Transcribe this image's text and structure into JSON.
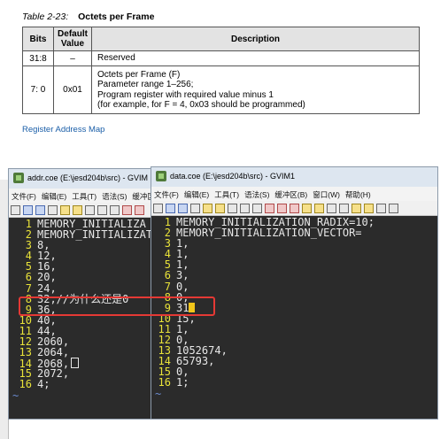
{
  "document": {
    "caption_prefix": "Table 2-23:",
    "caption_title": "Octets per Frame",
    "headers": [
      "Bits",
      "Default Value",
      "Description"
    ],
    "rows": [
      {
        "bits": "31:8",
        "default": "–",
        "description": [
          "Reserved"
        ]
      },
      {
        "bits": "7: 0",
        "default": "0x01",
        "description": [
          "Octets per Frame (F)",
          "Parameter range 1–256;",
          "Program register with required value minus 1",
          "(for example, for F = 4, 0x03 should be programmed)"
        ]
      }
    ],
    "link": "Register Address Map"
  },
  "left_window": {
    "title": "addr.coe (E:\\jesd204b\\src) - GVIM",
    "menu": [
      "文件(F)",
      "编辑(E)",
      "工具(T)",
      "语法(S)",
      "缓冲区"
    ],
    "lines": [
      {
        "n": "1",
        "text": "MEMORY_INITIALIZA"
      },
      {
        "n": "2",
        "text": "MEMORY_INITIALIZAT"
      },
      {
        "n": "3",
        "text": "8,"
      },
      {
        "n": "4",
        "text": "12,"
      },
      {
        "n": "5",
        "text": "16,"
      },
      {
        "n": "6",
        "text": "20,"
      },
      {
        "n": "7",
        "text": "24,"
      },
      {
        "n": "8",
        "text": "32,//为什么还是0"
      },
      {
        "n": "9",
        "text": "36,"
      },
      {
        "n": "10",
        "text": "40,"
      },
      {
        "n": "11",
        "text": "44,"
      },
      {
        "n": "12",
        "text": "2060,"
      },
      {
        "n": "13",
        "text": "2064,"
      },
      {
        "n": "14",
        "text": "2068,"
      },
      {
        "n": "15",
        "text": "2072,"
      },
      {
        "n": "16",
        "text": "4;"
      }
    ],
    "tilde": "~"
  },
  "right_window": {
    "title": "data.coe (E:\\jesd204b\\src) - GVIM1",
    "menu": [
      "文件(F)",
      "编辑(E)",
      "工具(T)",
      "语法(S)",
      "缓冲区(B)",
      "窗口(W)",
      "帮助(H)"
    ],
    "lines": [
      {
        "n": "1",
        "text": "MEMORY_INITIALIZATION_RADIX=10;"
      },
      {
        "n": "2",
        "text": "MEMORY_INITIALIZATION_VECTOR="
      },
      {
        "n": "3",
        "text": "1,"
      },
      {
        "n": "4",
        "text": "1,"
      },
      {
        "n": "5",
        "text": "1,"
      },
      {
        "n": "6",
        "text": "3,"
      },
      {
        "n": "7",
        "text": "0,"
      },
      {
        "n": "8",
        "text": "0,"
      },
      {
        "n": "9",
        "text": "31"
      },
      {
        "n": "10",
        "text": "15,"
      },
      {
        "n": "11",
        "text": "1,"
      },
      {
        "n": "12",
        "text": "0,"
      },
      {
        "n": "13",
        "text": "1052674,"
      },
      {
        "n": "14",
        "text": "65793,"
      },
      {
        "n": "15",
        "text": "0,"
      },
      {
        "n": "16",
        "text": "1;"
      }
    ],
    "tilde": "~"
  },
  "colors": {
    "editor_bg": "#2b2b2b",
    "line_number": "#e9e339",
    "text": "#e8e8e8",
    "highlight": "#e53935",
    "link": "#1a5ea8",
    "cursor": "#f0c419"
  }
}
